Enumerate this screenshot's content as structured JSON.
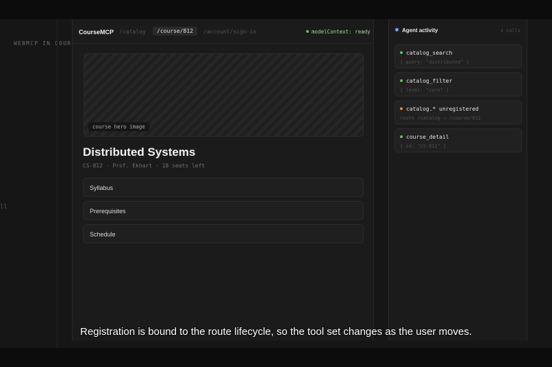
{
  "outer": {
    "label": "WEBMCP IN COURSEMCP",
    "fragment": "ll"
  },
  "browser": {
    "brand": "CourseMCP",
    "routes": [
      "/catalog",
      "/course/812",
      "/account/sign-in"
    ],
    "model_context_status": "modelContext: ready"
  },
  "course": {
    "hero_label": "course hero image",
    "title": "Distributed Systems",
    "meta": "CS-812 · Prof. Ekhart · 18 seats left",
    "sections": [
      "Syllabus",
      "Prerequisites",
      "Schedule"
    ]
  },
  "agent_panel": {
    "title": "Agent activity",
    "count": "4 calls",
    "calls": [
      {
        "name": "catalog_search",
        "arg": "{ query: \"distributed\" }",
        "dot_color": "#5fbf6a"
      },
      {
        "name": "catalog_filter",
        "arg": "{ level: \"core\" }",
        "dot_color": "#5fbf6a"
      },
      {
        "name": "catalog.* unregistered",
        "arg": "route /catalog → /course/812",
        "dot_color": "#e08a3c"
      },
      {
        "name": "course_detail",
        "arg": "{ id: \"CS-812\" }",
        "dot_color": "#5fbf6a"
      }
    ]
  },
  "caption": "Registration is bound to the route lifecycle, so the tool set changes as the user moves."
}
